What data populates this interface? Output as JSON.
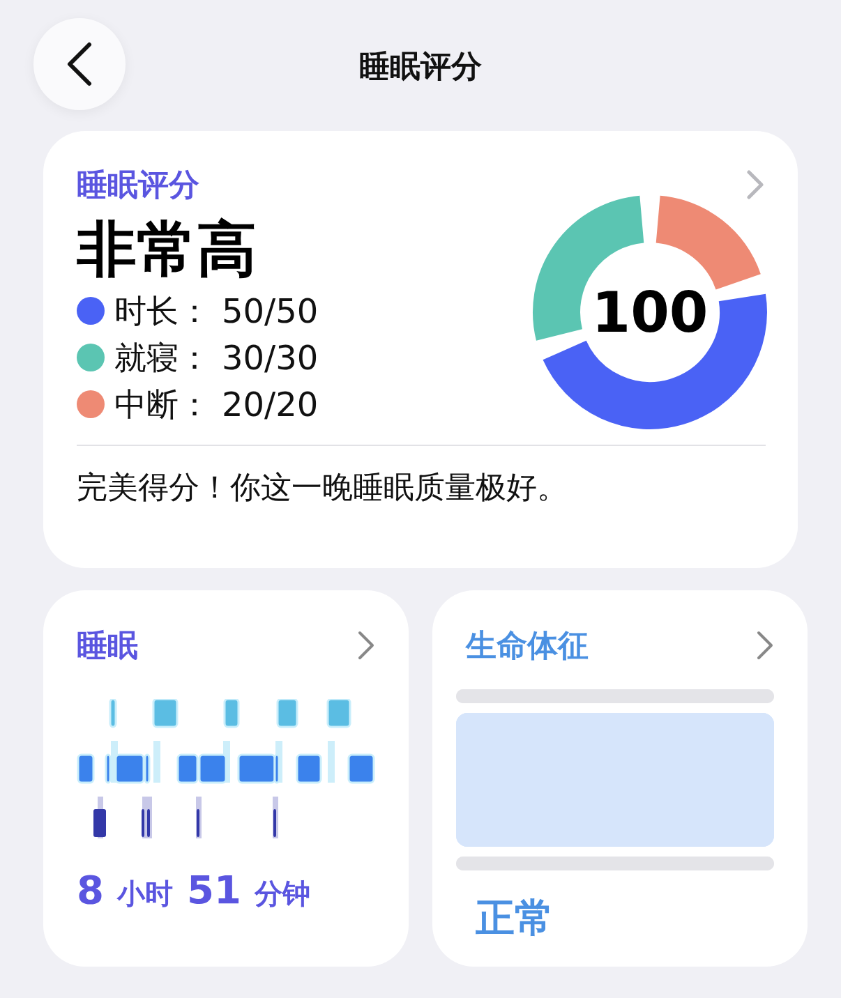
{
  "header": {
    "title": "睡眠评分"
  },
  "score_card": {
    "title": "睡眠评分",
    "rating": "非常高",
    "items": [
      {
        "label": "时长：",
        "score": "50/50",
        "color": "#4a62f5"
      },
      {
        "label": "就寝：",
        "score": "30/30",
        "color": "#5bc5b2"
      },
      {
        "label": "中断：",
        "score": "20/20",
        "color": "#ee8a74"
      }
    ],
    "total": "100",
    "message": "完美得分！你这一晚睡眠质量极好。"
  },
  "sleep_card": {
    "title": "睡眠",
    "duration": {
      "hours": "8",
      "hours_unit": "小时",
      "minutes": "51",
      "minutes_unit": "分钟"
    }
  },
  "vitals_card": {
    "title": "生命体征",
    "status": "正常"
  }
}
